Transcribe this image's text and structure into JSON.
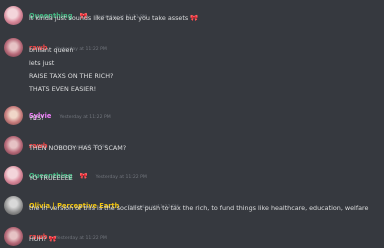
{
  "colors": {
    "background": "#36393f",
    "queenthing": "#43b581",
    "rawb": "#f04747",
    "sylvie": "#f47fff",
    "olivia": "#f1c40f",
    "timestamp": "#72767d",
    "text": "#dcddde"
  },
  "messages": [
    {
      "author": "Queenthing",
      "timestamp": "Yesterday at 11:21 PM",
      "lines": [
        "it kinda just sounds like taxes but you take assets"
      ],
      "emoji": "🎀",
      "avatar": "pink-avatar"
    },
    {
      "author": "rawb",
      "timestamp": "Yesterday at 11:22 PM",
      "lines": [
        "brillant queen",
        "lets just",
        "RAISE TAXS ON THE RICH?",
        "THATS EVEN EASIER!"
      ],
      "avatar": "rose-avatar"
    },
    {
      "author": "Sylvie",
      "timestamp": "Yesterday at 11:22 PM",
      "lines": [
        "YES!"
      ],
      "avatar": "sylvie-avatar"
    },
    {
      "author": "rawb",
      "timestamp": "Yesterday at 11:22 PM",
      "lines": [
        "THEN NOBODY HAS TO SCAM?"
      ],
      "avatar": "rose-avatar"
    },
    {
      "author": "Queenthing",
      "timestamp": "Yesterday at 11:22 PM",
      "lines": [
        "YO TRUEEEEE"
      ],
      "emoji": "🎀",
      "avatar": "pink-avatar"
    },
    {
      "author": "Olivia | Perceptive Earth",
      "timestamp": "Yesterday at 11:22 PM",
      "lines": [
        "the irl version of this is the socialist push to tax the rich, to fund things like healthcare, education, welfare"
      ],
      "avatar": "grey-avatar"
    },
    {
      "author": "rawb",
      "timestamp": "Yesterday at 11:22 PM",
      "lines": [
        "HUH?"
      ],
      "emoji": "🎀",
      "avatar": "rose-avatar"
    }
  ]
}
